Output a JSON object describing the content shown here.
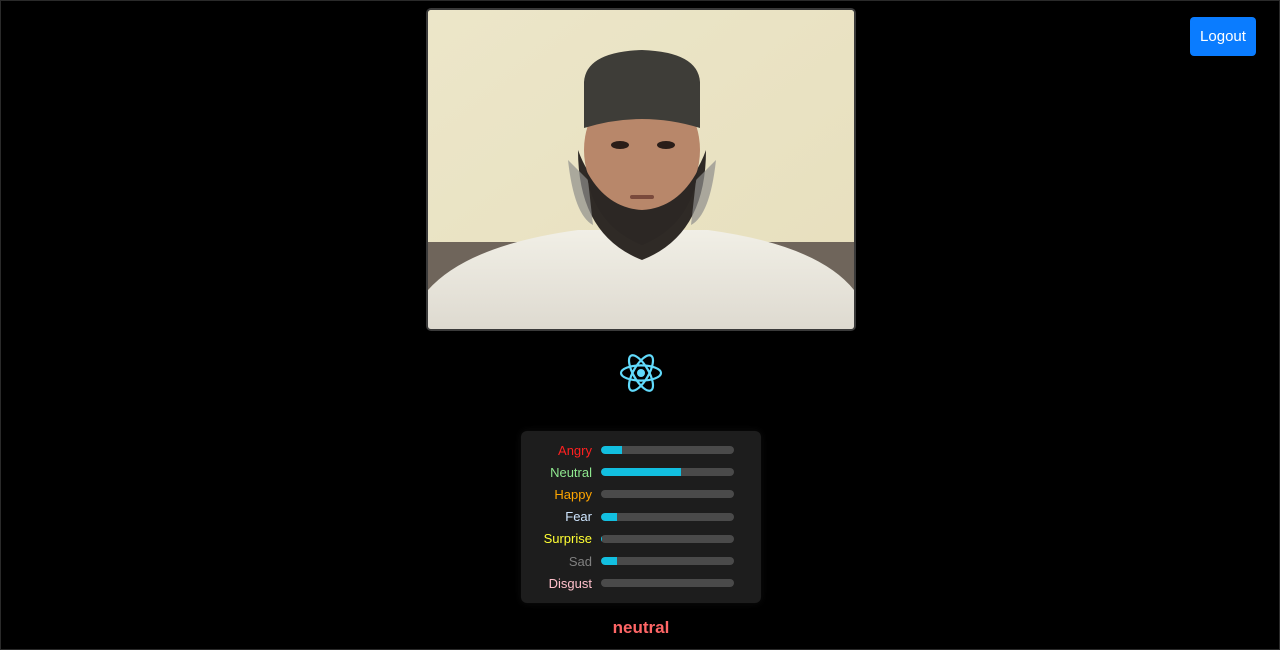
{
  "header": {
    "logout_label": "Logout"
  },
  "video": {
    "icon": "webcam-feed"
  },
  "logo": {
    "icon": "react-logo-icon",
    "color": "#61dafb"
  },
  "emotions": [
    {
      "label": "Angry",
      "value": 0.16,
      "color": "#ff2020"
    },
    {
      "label": "Neutral",
      "value": 0.6,
      "color": "#8fe88f"
    },
    {
      "label": "Happy",
      "value": 0.0,
      "color": "#ffa500"
    },
    {
      "label": "Fear",
      "value": 0.12,
      "color": "#cfe6ff"
    },
    {
      "label": "Surprise",
      "value": 0.01,
      "color": "#ffff33"
    },
    {
      "label": "Sad",
      "value": 0.12,
      "color": "#808080"
    },
    {
      "label": "Disgust",
      "value": 0.0,
      "color": "#ffc0cb"
    }
  ],
  "bar_color": "#12bfe0",
  "result": {
    "text": "neutral",
    "color": "#ff6666"
  }
}
